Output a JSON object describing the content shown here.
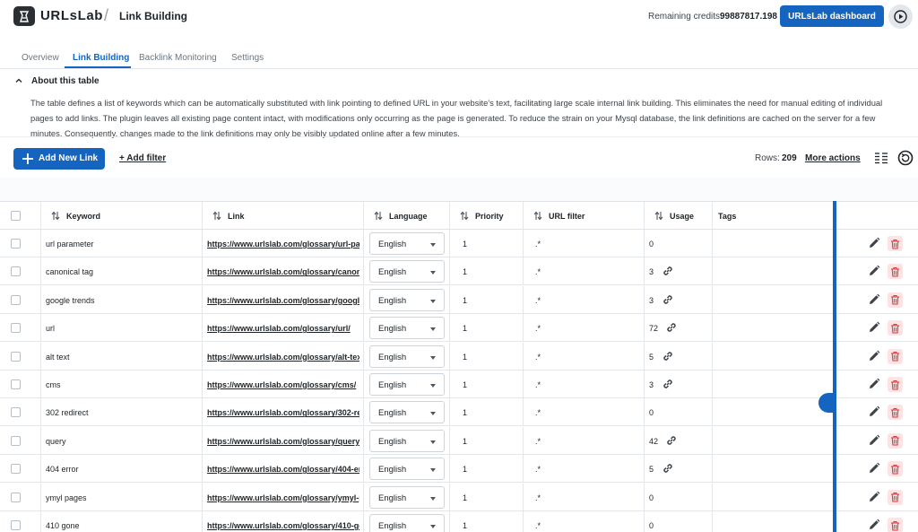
{
  "header": {
    "logo_text": "URLsLab",
    "separator": "/",
    "title": "Link Building",
    "credits_label": "Remaining credits:",
    "credits_value": "99887817.198",
    "dashboard_button": "URLsLab dashboard"
  },
  "tabs": [
    {
      "label": "Overview",
      "active": false
    },
    {
      "label": "Link Building",
      "active": true
    },
    {
      "label": "Backlink Monitoring",
      "active": false
    },
    {
      "label": "Settings",
      "active": false
    }
  ],
  "about": {
    "title": "About this table",
    "text": "The table defines a list of keywords which can be automatically substituted with link pointing to defined URL in your website's text, facilitating large scale internal link building. This eliminates the need for manual editing of individual pages to add links. The plugin leaves all existing page content intact, with modifications only occurring as the page is generated. To reduce the strain on your Mysql database, the link definitions are cached on the server for a few minutes. Consequently, changes made to the link definitions may only be visibly updated online after a few minutes."
  },
  "toolbar": {
    "add_button": "Add New Link",
    "add_filter": "+ Add filter",
    "rows_label": "Rows:",
    "rows_value": "209",
    "more_actions": "More actions"
  },
  "table": {
    "columns": [
      "Keyword",
      "Link",
      "Language",
      "Priority",
      "URL filter",
      "Usage",
      "Tags"
    ],
    "rows": [
      {
        "keyword": "url parameter",
        "link": "https://www.urlslab.com/glossary/url-par...",
        "language": "English",
        "priority": "1",
        "url_filter": ".*",
        "usage": "0",
        "has_usage_link": false
      },
      {
        "keyword": "canonical tag",
        "link": "https://www.urlslab.com/glossary/canoni...",
        "language": "English",
        "priority": "1",
        "url_filter": ".*",
        "usage": "3",
        "has_usage_link": true
      },
      {
        "keyword": "google trends",
        "link": "https://www.urlslab.com/glossary/google...",
        "language": "English",
        "priority": "1",
        "url_filter": ".*",
        "usage": "3",
        "has_usage_link": true
      },
      {
        "keyword": "url",
        "link": "https://www.urlslab.com/glossary/url/",
        "language": "English",
        "priority": "1",
        "url_filter": ".*",
        "usage": "72",
        "has_usage_link": true
      },
      {
        "keyword": "alt text",
        "link": "https://www.urlslab.com/glossary/alt-text/",
        "language": "English",
        "priority": "1",
        "url_filter": ".*",
        "usage": "5",
        "has_usage_link": true
      },
      {
        "keyword": "cms",
        "link": "https://www.urlslab.com/glossary/cms/",
        "language": "English",
        "priority": "1",
        "url_filter": ".*",
        "usage": "3",
        "has_usage_link": true
      },
      {
        "keyword": "302 redirect",
        "link": "https://www.urlslab.com/glossary/302-re...",
        "language": "English",
        "priority": "1",
        "url_filter": ".*",
        "usage": "0",
        "has_usage_link": false
      },
      {
        "keyword": "query",
        "link": "https://www.urlslab.com/glossary/query/",
        "language": "English",
        "priority": "1",
        "url_filter": ".*",
        "usage": "42",
        "has_usage_link": true
      },
      {
        "keyword": "404 error",
        "link": "https://www.urlslab.com/glossary/404-err...",
        "language": "English",
        "priority": "1",
        "url_filter": ".*",
        "usage": "5",
        "has_usage_link": true
      },
      {
        "keyword": "ymyl pages",
        "link": "https://www.urlslab.com/glossary/ymyl-p...",
        "language": "English",
        "priority": "1",
        "url_filter": ".*",
        "usage": "0",
        "has_usage_link": false
      },
      {
        "keyword": "410 gone",
        "link": "https://www.urlslab.com/glossary/410-go...",
        "language": "English",
        "priority": "1",
        "url_filter": ".*",
        "usage": "0",
        "has_usage_link": false
      }
    ]
  },
  "colors": {
    "accent": "#1565c0",
    "delete_bg": "#fde3e3",
    "delete_icon": "#d63638"
  },
  "icons": {
    "logo": "urlslab-logo-icon",
    "play": "play-icon",
    "collapse": "chevron-up-icon",
    "add": "plus-icon",
    "columns": "columns-icon",
    "refresh": "refresh-icon",
    "sort": "sort-icon",
    "usage": "link-chain-icon",
    "edit": "pencil-icon",
    "delete": "trash-icon"
  }
}
